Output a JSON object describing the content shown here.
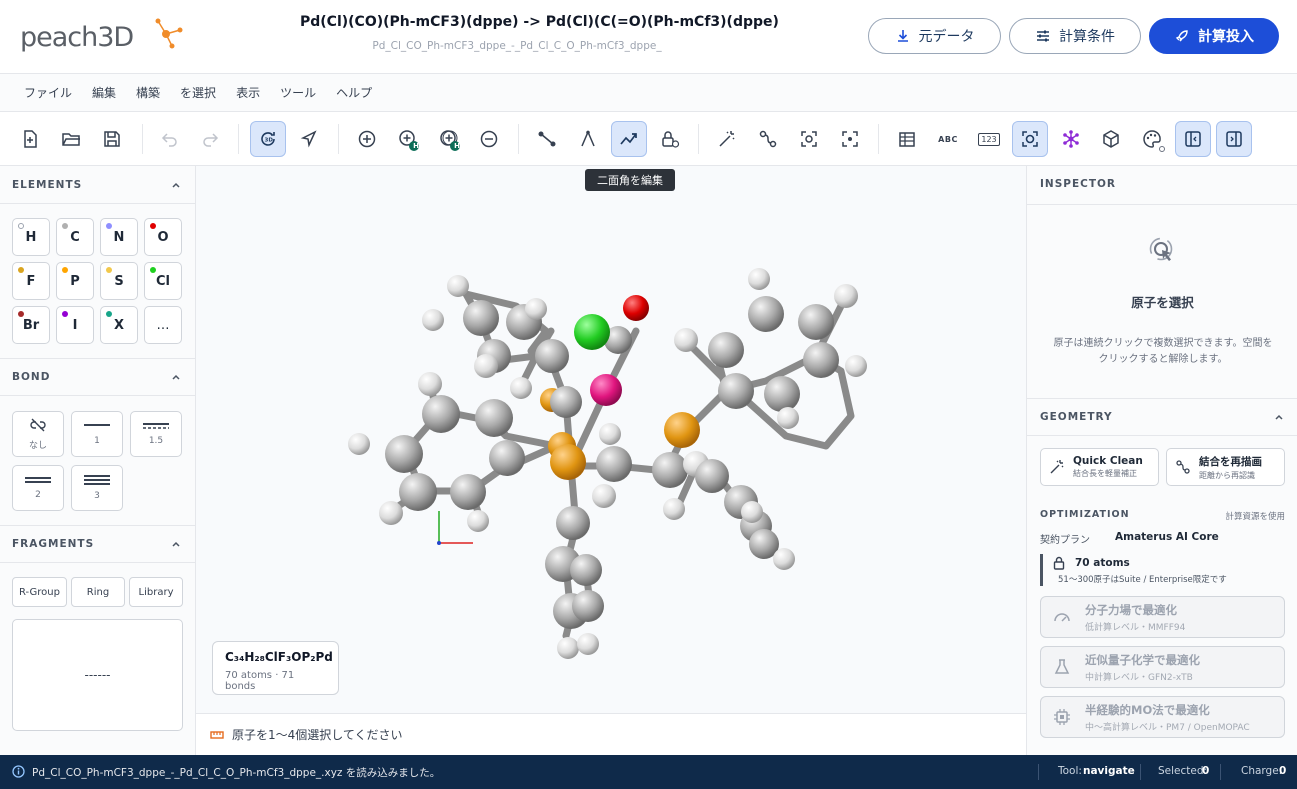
{
  "header": {
    "logo_text": "peach3D",
    "title": "Pd(Cl)(CO)(Ph-mCF3)(dppe) -> Pd(Cl)(C(=O)(Ph-mCf3)(dppe)",
    "subtitle": "Pd_Cl_CO_Ph-mCF3_dppe_-_Pd_Cl_C_O_Ph-mCf3_dppe_",
    "btn_source": "元データ",
    "btn_settings": "計算条件",
    "btn_submit": "計算投入",
    "primary_color": "#1d4ed8"
  },
  "menu": [
    "ファイル",
    "編集",
    "構築",
    "を選択",
    "表示",
    "ツール",
    "ヘルプ"
  ],
  "toolbar": {
    "tooltip": "二面角を編集",
    "h_badge": "H",
    "abc": "ABC",
    "num": "123"
  },
  "left": {
    "elements_title": "ELEMENTS",
    "elements": [
      {
        "sym": "H",
        "color": "#ffffff"
      },
      {
        "sym": "C",
        "color": "#b0b0b0"
      },
      {
        "sym": "N",
        "color": "#8f8fff"
      },
      {
        "sym": "O",
        "color": "#e00000"
      },
      {
        "sym": "F",
        "color": "#daa520"
      },
      {
        "sym": "P",
        "color": "#ffa500"
      },
      {
        "sym": "S",
        "color": "#f2c84b"
      },
      {
        "sym": "Cl",
        "color": "#1fd01f"
      },
      {
        "sym": "Br",
        "color": "#a52a2a"
      },
      {
        "sym": "I",
        "color": "#9400d3"
      },
      {
        "sym": "X",
        "color": "#17a589"
      },
      {
        "sym": "…",
        "color": ""
      }
    ],
    "bond_title": "BOND",
    "bonds": [
      "なし",
      "1",
      "1.5",
      "2",
      "3"
    ],
    "fragments_title": "FRAGMENTS",
    "fragments": [
      "R-Group",
      "Ring",
      "Library"
    ],
    "fragment_preview": "------"
  },
  "canvas": {
    "formula": "C₃₄H₂₈ClF₃OP₂Pd",
    "formula_stats": "70 atoms · 71 bonds",
    "measure_hint": "原子を1〜4個選択してください"
  },
  "right": {
    "inspector_title": "INSPECTOR",
    "select_title": "原子を選択",
    "select_desc": "原子は連続クリックで複数選択できます。空間をクリックすると解除します。",
    "geometry_title": "GEOMETRY",
    "quick_clean": "Quick Clean",
    "quick_clean_sub": "結合長を軽量補正",
    "redraw": "結合を再描画",
    "redraw_sub": "距離から再認識",
    "optimization_title": "OPTIMIZATION",
    "optimization_note": "計算資源を使用",
    "plan_label": "契約プラン",
    "plan_value": "Amaterus AI Core",
    "atoms_count": "70 atoms",
    "atoms_note": "51〜300原子はSuite / Enterprise限定です",
    "opt": [
      {
        "title": "分子力場で最適化",
        "sub": "低計算レベル・MMFF94"
      },
      {
        "title": "近似量子化学で最適化",
        "sub": "中計算レベル・GFN2-xTB"
      },
      {
        "title": "半経験的MO法で最適化",
        "sub": "中〜高計算レベル・PM7 / OpenMOPAC"
      }
    ]
  },
  "status": {
    "message": "Pd_Cl_CO_Ph-mCF3_dppe_-_Pd_Cl_C_O_Ph-mCf3_dppe_.xyz を読み込みました。",
    "tool_label": "Tool:",
    "tool_value": "navigate",
    "selected_label": "Selected:",
    "selected_value": "0",
    "charge_label": "Charge:",
    "charge_value": "0"
  }
}
